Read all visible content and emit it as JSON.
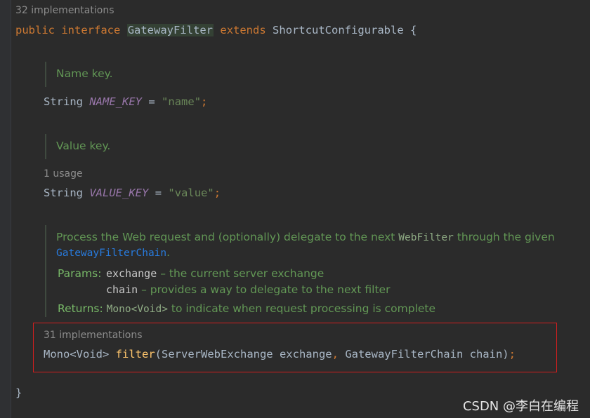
{
  "editor": {
    "interface_hint": "32 implementations",
    "decl": {
      "kw_public": "public",
      "kw_interface": "interface",
      "class_name": "GatewayFilter",
      "kw_extends": "extends",
      "parent": "ShortcutConfigurable",
      "open_brace": "{"
    },
    "name_key": {
      "doc": "Name key.",
      "type": "String",
      "field": "NAME_KEY",
      "eq": "=",
      "value": "\"name\"",
      "semi": ";"
    },
    "value_key": {
      "doc": "Value key.",
      "usage_hint": "1 usage",
      "type": "String",
      "field": "VALUE_KEY",
      "eq": "=",
      "value": "\"value\"",
      "semi": ";"
    },
    "filter_doc": {
      "line1_text": "Process the Web request and (optionally) delegate to the next",
      "line1_code": "WebFilter",
      "line1_tail": "through the given",
      "line2_link": "GatewayFilterChain",
      "line2_tail": ".",
      "params_label": "Params:",
      "param1_name": "exchange",
      "param1_desc": "– the current server exchange",
      "param2_name": "chain",
      "param2_desc": "– provides a way to delegate to the next filter",
      "returns_label": "Returns:",
      "returns_code": "Mono<Void>",
      "returns_desc": "to indicate when request processing is complete"
    },
    "filter_method": {
      "impl_hint": "31 implementations",
      "return_type": "Mono<Void>",
      "name": "filter",
      "params_open": "(ServerWebExchange exchange",
      "comma": ",",
      "params_rest": " GatewayFilterChain chain)",
      "semi": ";"
    },
    "close_brace": "}"
  },
  "watermark": "CSDN @李白在编程",
  "colors": {
    "background": "#2b2b2b",
    "keyword": "#cc7832",
    "doc_comment": "#629755",
    "field": "#9876aa",
    "string": "#6a8759",
    "method": "#ffc66d",
    "highlight_border": "#d21e1e"
  }
}
